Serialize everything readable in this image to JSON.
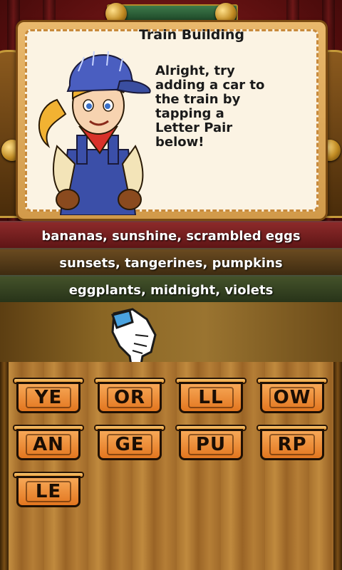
{
  "dialog": {
    "title": "Train Building",
    "body": "Alright, try\nadding a car to\nthe train by\ntapping a\nLetter Pair\nbelow!"
  },
  "hints": [
    "bananas, sunshine, scrambled eggs",
    "sunsets, tangerines, pumpkins",
    "eggplants, midnight, violets"
  ],
  "tiles": [
    "YE",
    "OR",
    "LL",
    "OW",
    "AN",
    "GE",
    "PU",
    "RP",
    "LE"
  ],
  "colors": {
    "tile_fill": "#f29a45",
    "hint_red": "#7a2020",
    "hint_brown": "#553a18",
    "hint_green": "#364224",
    "card_background": "#fbf3e3"
  }
}
